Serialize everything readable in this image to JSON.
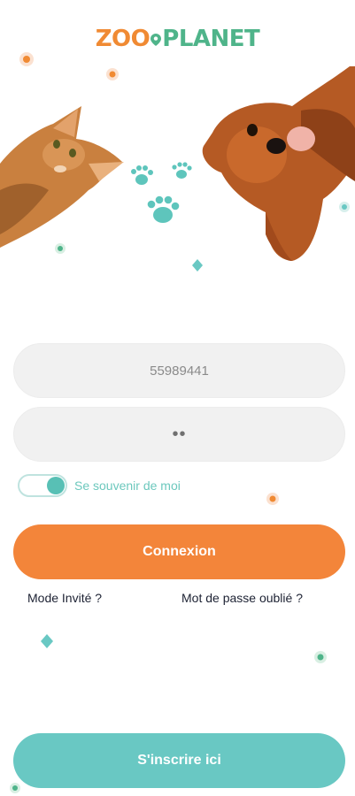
{
  "logo": {
    "part1": "ZOO",
    "part2": "PLANET"
  },
  "login_form": {
    "username_value": "55989441",
    "password_value": "••",
    "remember_label": "Se souvenir de moi",
    "remember_on": true,
    "login_button": "Connexion",
    "guest_link": "Mode Invité ?",
    "forgot_link": "Mot de passe oublié ?",
    "signup_button": "S'inscrire ici"
  },
  "colors": {
    "orange": "#f3853a",
    "teal": "#69c8c3",
    "green": "#4fb48a"
  },
  "icons": [
    "paw-print-icon",
    "toggle-switch",
    "location-pin-icon"
  ]
}
